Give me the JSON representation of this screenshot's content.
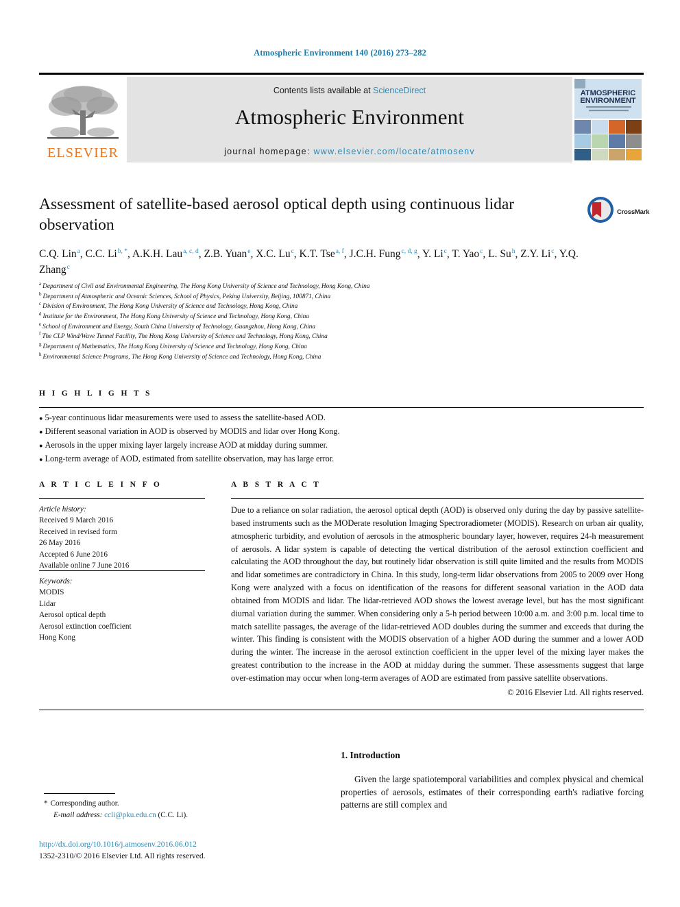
{
  "running_head": "Atmospheric Environment 140 (2016) 273–282",
  "masthead": {
    "publisher_logo_text": "ELSEVIER",
    "contents_prefix": "Contents lists available at ",
    "contents_link": "ScienceDirect",
    "journal_name": "Atmospheric Environment",
    "homepage_prefix": "journal homepage: ",
    "homepage_url": "www.elsevier.com/locate/atmosenv",
    "cover_title_line1": "ATMOSPHERIC",
    "cover_title_line2": "ENVIRONMENT"
  },
  "article": {
    "title": "Assessment of satellite-based aerosol optical depth using continuous lidar observation",
    "crossmark_label": "CrossMark",
    "authors": [
      {
        "name": "C.Q. Lin",
        "affils": "a",
        "star": false
      },
      {
        "name": "C.C. Li",
        "affils": "b",
        "star": true
      },
      {
        "name": "A.K.H. Lau",
        "affils": "a, c, d",
        "star": false
      },
      {
        "name": "Z.B. Yuan",
        "affils": "e",
        "star": false
      },
      {
        "name": "X.C. Lu",
        "affils": "c",
        "star": false
      },
      {
        "name": "K.T. Tse",
        "affils": "a, f",
        "star": false
      },
      {
        "name": "J.C.H. Fung",
        "affils": "c, d, g",
        "star": false
      },
      {
        "name": "Y. Li",
        "affils": "c",
        "star": false
      },
      {
        "name": "T. Yao",
        "affils": "c",
        "star": false
      },
      {
        "name": "L. Su",
        "affils": "h",
        "star": false
      },
      {
        "name": "Z.Y. Li",
        "affils": "c",
        "star": false
      },
      {
        "name": "Y.Q. Zhang",
        "affils": "c",
        "star": false
      }
    ],
    "affiliations": [
      {
        "key": "a",
        "text": "Department of Civil and Environmental Engineering, The Hong Kong University of Science and Technology, Hong Kong, China"
      },
      {
        "key": "b",
        "text": "Department of Atmospheric and Oceanic Sciences, School of Physics, Peking University, Beijing, 100871, China"
      },
      {
        "key": "c",
        "text": "Division of Environment, The Hong Kong University of Science and Technology, Hong Kong, China"
      },
      {
        "key": "d",
        "text": "Institute for the Environment, The Hong Kong University of Science and Technology, Hong Kong, China"
      },
      {
        "key": "e",
        "text": "School of Environment and Energy, South China University of Technology, Guangzhou, Hong Kong, China"
      },
      {
        "key": "f",
        "text": "The CLP Wind/Wave Tunnel Facility, The Hong Kong University of Science and Technology, Hong Kong, China"
      },
      {
        "key": "g",
        "text": "Department of Mathematics, The Hong Kong University of Science and Technology, Hong Kong, China"
      },
      {
        "key": "h",
        "text": "Environmental Science Programs, The Hong Kong University of Science and Technology, Hong Kong, China"
      }
    ]
  },
  "highlights": {
    "heading": "H I G H L I G H T S",
    "items": [
      "5-year continuous lidar measurements were used to assess the satellite-based AOD.",
      "Different seasonal variation in AOD is observed by MODIS and lidar over Hong Kong.",
      "Aerosols in the upper mixing layer largely increase AOD at midday during summer.",
      "Long-term average of AOD, estimated from satellite observation, may has large error."
    ]
  },
  "article_info": {
    "heading": "A R T I C L E  I N F O",
    "history_label": "Article history:",
    "history": [
      "Received 9 March 2016",
      "Received in revised form",
      "26 May 2016",
      "Accepted 6 June 2016",
      "Available online 7 June 2016"
    ],
    "keywords_label": "Keywords:",
    "keywords": [
      "MODIS",
      "Lidar",
      "Aerosol optical depth",
      "Aerosol extinction coefficient",
      "Hong Kong"
    ]
  },
  "abstract": {
    "heading": "A B S T R A C T",
    "text": "Due to a reliance on solar radiation, the aerosol optical depth (AOD) is observed only during the day by passive satellite-based instruments such as the MODerate resolution Imaging Spectroradiometer (MODIS). Research on urban air quality, atmospheric turbidity, and evolution of aerosols in the atmospheric boundary layer, however, requires 24-h measurement of aerosols. A lidar system is capable of detecting the vertical distribution of the aerosol extinction coefficient and calculating the AOD throughout the day, but routinely lidar observation is still quite limited and the results from MODIS and lidar sometimes are contradictory in China. In this study, long-term lidar observations from 2005 to 2009 over Hong Kong were analyzed with a focus on identification of the reasons for different seasonal variation in the AOD data obtained from MODIS and lidar. The lidar-retrieved AOD shows the lowest average level, but has the most significant diurnal variation during the summer. When considering only a 5-h period between 10:00 a.m. and 3:00 p.m. local time to match satellite passages, the average of the lidar-retrieved AOD doubles during the summer and exceeds that during the winter. This finding is consistent with the MODIS observation of a higher AOD during the summer and a lower AOD during the winter. The increase in the aerosol extinction coefficient in the upper level of the mixing layer makes the greatest contribution to the increase in the AOD at midday during the summer. These assessments suggest that large over-estimation may occur when long-term averages of AOD are estimated from passive satellite observations.",
    "copyright": "© 2016 Elsevier Ltd. All rights reserved."
  },
  "introduction": {
    "heading": "1. Introduction",
    "text": "Given the large spatiotemporal variabilities and complex physical and chemical properties of aerosols, estimates of their corresponding earth's radiative forcing patterns are still complex and"
  },
  "footer": {
    "corresponding_author": "Corresponding author.",
    "email_label": "E-mail address:",
    "email": "ccli@pku.edu.cn",
    "email_suffix": "(C.C. Li).",
    "doi": "http://dx.doi.org/10.1016/j.atmosenv.2016.06.012",
    "issn_line": "1352-2310/© 2016 Elsevier Ltd. All rights reserved."
  },
  "colors": {
    "link_blue": "#2b8ab5",
    "elsevier_orange": "#E87722",
    "band_gray": "#e3e3e3"
  }
}
